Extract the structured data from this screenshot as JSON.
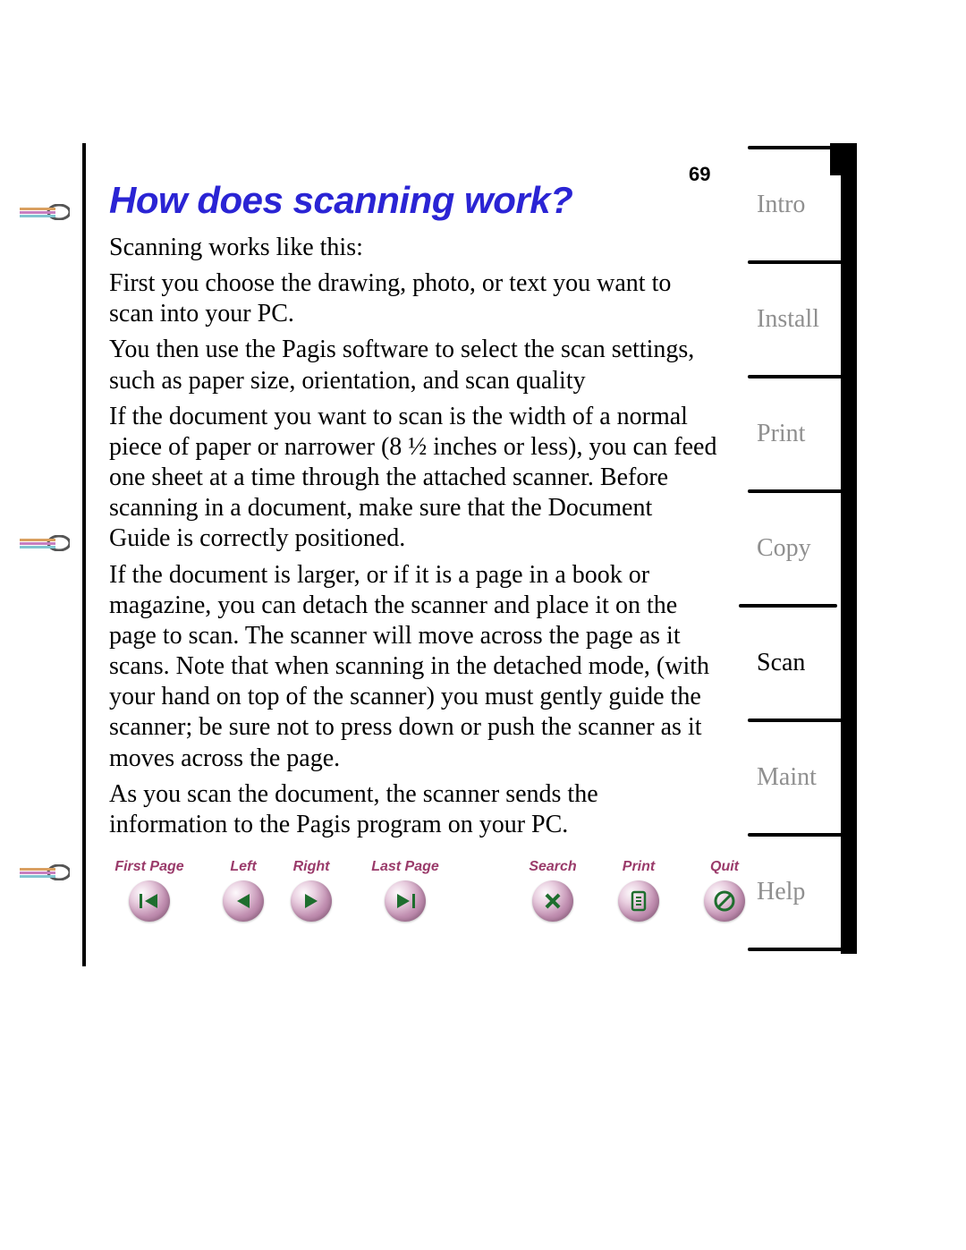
{
  "page_number": "69",
  "heading": "How does scanning work?",
  "paragraphs": {
    "p1": "Scanning works like this:",
    "p2": "First you choose the drawing, photo, or text you want to scan into your PC.",
    "p3": "You then use the Pagis software to select the scan settings, such as paper size, orientation, and scan quality",
    "p4": "If the document you want to scan is the width of a normal piece of paper or narrower (8 ½ inches or less), you can feed one sheet at a time through the attached scanner. Before scanning in a document, make sure that the Document Guide is correctly positioned.",
    "p5": "If the document is larger, or if it is a page in a book or magazine, you can detach the scanner and place it on the page to scan. The scanner will move across the page as it scans. Note that when scanning in the detached mode, (with your hand on top of the scanner) you must gently guide the scanner; be sure not to press down or push the scanner as it moves across the page.",
    "p6": "As you scan the document, the scanner sends the information to the Pagis program on your PC."
  },
  "side_tabs": {
    "t0": "Intro",
    "t1": "Install",
    "t2": "Print",
    "t3": "Copy",
    "t4": "Scan",
    "t5": "Maint",
    "t6": "Help"
  },
  "nav": {
    "first": "First Page",
    "left": "Left",
    "right": "Right",
    "last": "Last Page",
    "search": "Search",
    "print": "Print",
    "quit": "Quit"
  }
}
